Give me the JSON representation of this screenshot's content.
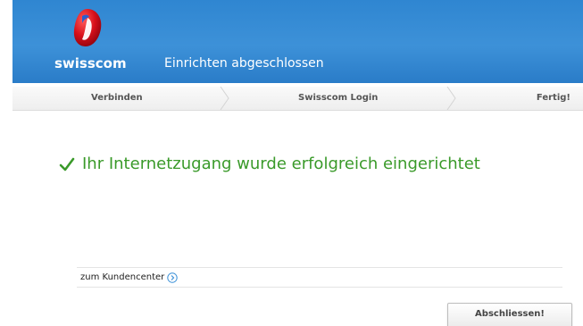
{
  "header": {
    "logo_text": "swisscom",
    "title": "Einrichten abgeschlossen"
  },
  "steps": [
    {
      "label": "Verbinden"
    },
    {
      "label": "Swisscom Login"
    },
    {
      "label": "Fertig!"
    }
  ],
  "main": {
    "success_message": "Ihr Internetzugang wurde erfolgreich eingerichtet",
    "kundencenter_link": "zum Kundencenter",
    "finish_button": "Abschliessen!"
  },
  "colors": {
    "header_blue": "#3d91d8",
    "success_green": "#3a9a2a",
    "logo_red": "#d8101a"
  },
  "icons": {
    "logo": "swisscom-logo-icon",
    "success": "checkmark-icon",
    "link_arrow": "circle-arrow-right-icon"
  }
}
